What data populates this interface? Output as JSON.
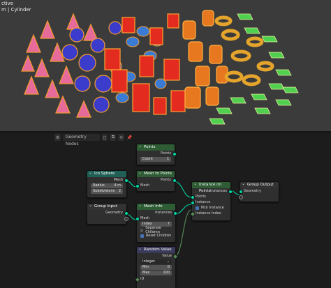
{
  "viewport": {
    "line1": "ctive",
    "line2": "m | Cylinder"
  },
  "editor": {
    "title": "Geometry Nodes"
  },
  "nodes": {
    "points": {
      "title": "Points",
      "out_points": "Points",
      "count_label": "Count",
      "count_value": "1"
    },
    "ico_sphere": {
      "title": "Ico Sphere",
      "out_mesh": "Mesh",
      "radius_label": "Radius",
      "radius_value": "4 m",
      "subdiv_label": "Subdivisions",
      "subdiv_value": "2"
    },
    "mesh_to_points": {
      "title": "Mesh to Points",
      "out_points": "Points",
      "in_mesh": "Mesh"
    },
    "group_input": {
      "title": "Group Input",
      "out_geometry": "Geometry"
    },
    "mesh_info": {
      "title": "Mesh Info",
      "out_instances": "Instances",
      "in_mesh": "Mesh",
      "index_label": "Index",
      "index_value": "7",
      "separate": "Separate Children",
      "reset": "Reset Children"
    },
    "instance_on_points": {
      "title": "Instance on Points",
      "out_instances": "Instances",
      "in_points": "Points",
      "in_instance": "Instance",
      "pick_instance": "Pick Instance",
      "instance_index": "Instance Index"
    },
    "group_output": {
      "title": "Group Output",
      "in_geometry": "Geometry"
    },
    "random_value": {
      "title": "Random Value",
      "out_value": "Value",
      "type_value": "Integer",
      "min_label": "Min",
      "min_value": "0",
      "max_label": "Max",
      "max_value": "100",
      "id_label": "ID"
    }
  },
  "colors": {
    "geometry_socket": "#00d6a3",
    "integer_socket": "#598c5c",
    "selection_outline": "#ffa033",
    "green_instance": "#4fd04f",
    "viewport_bg": "#3b3b3b"
  }
}
